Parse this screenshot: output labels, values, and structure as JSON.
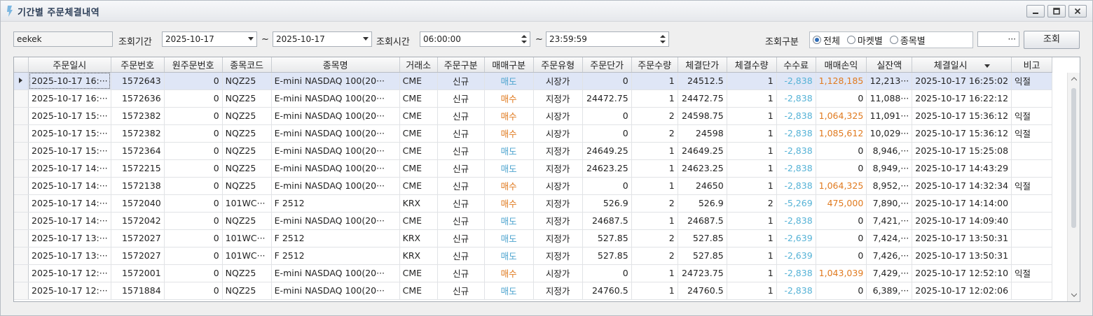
{
  "window": {
    "title": "기간별 주문체결내역",
    "controls": [
      "minimize-icon",
      "maximize-icon",
      "close-icon"
    ]
  },
  "toolbar": {
    "account": "eekek",
    "period_label": "조회기간",
    "date_from": "2025-10-17",
    "tilde1": "~",
    "date_to": "2025-10-17",
    "time_label": "조회시간",
    "time_from": "06:00:00",
    "tilde2": "~",
    "time_to": "23:59:59",
    "category_label": "조회구분",
    "radio_all": "전체",
    "radio_market": "마켓별",
    "radio_item": "종목별",
    "more_label": "···",
    "search_label": "조회"
  },
  "grid": {
    "columns": [
      "주문일시",
      "주문번호",
      "원주문번호",
      "종목코드",
      "종목명",
      "거래소",
      "주문구분",
      "매매구분",
      "주문유형",
      "주문단가",
      "주문수량",
      "체결단가",
      "체결수량",
      "수수료",
      "매매손익",
      "실잔액",
      "체결일시",
      "비고"
    ],
    "rows": [
      [
        "2025-10-17 16:···",
        "1572643",
        "0",
        "NQZ25",
        "E-mini NASDAQ 100(20···",
        "CME",
        "신규",
        "매도",
        "시장가",
        "0",
        "1",
        "24512.5",
        "1",
        "-2,838",
        "1,128,185",
        "12,213···",
        "2025-10-17 16:25:02",
        "익절"
      ],
      [
        "2025-10-17 16:···",
        "1572636",
        "0",
        "NQZ25",
        "E-mini NASDAQ 100(20···",
        "CME",
        "신규",
        "매수",
        "지정가",
        "24472.75",
        "1",
        "24472.75",
        "1",
        "-2,838",
        "0",
        "11,088···",
        "2025-10-17 16:22:12",
        ""
      ],
      [
        "2025-10-17 15:···",
        "1572382",
        "0",
        "NQZ25",
        "E-mini NASDAQ 100(20···",
        "CME",
        "신규",
        "매수",
        "시장가",
        "0",
        "2",
        "24598.75",
        "1",
        "-2,838",
        "1,064,325",
        "11,091···",
        "2025-10-17 15:36:12",
        "익절"
      ],
      [
        "2025-10-17 15:···",
        "1572382",
        "0",
        "NQZ25",
        "E-mini NASDAQ 100(20···",
        "CME",
        "신규",
        "매수",
        "시장가",
        "0",
        "2",
        "24598",
        "1",
        "-2,838",
        "1,085,612",
        "10,029···",
        "2025-10-17 15:36:12",
        "익절"
      ],
      [
        "2025-10-17 15:···",
        "1572364",
        "0",
        "NQZ25",
        "E-mini NASDAQ 100(20···",
        "CME",
        "신규",
        "매도",
        "지정가",
        "24649.25",
        "1",
        "24649.25",
        "1",
        "-2,838",
        "0",
        "8,946,···",
        "2025-10-17 15:25:08",
        ""
      ],
      [
        "2025-10-17 14:···",
        "1572215",
        "0",
        "NQZ25",
        "E-mini NASDAQ 100(20···",
        "CME",
        "신규",
        "매도",
        "지정가",
        "24623.25",
        "1",
        "24623.25",
        "1",
        "-2,838",
        "0",
        "8,949,···",
        "2025-10-17 14:43:29",
        ""
      ],
      [
        "2025-10-17 14:···",
        "1572138",
        "0",
        "NQZ25",
        "E-mini NASDAQ 100(20···",
        "CME",
        "신규",
        "매수",
        "시장가",
        "0",
        "1",
        "24650",
        "1",
        "-2,838",
        "1,064,325",
        "8,952,···",
        "2025-10-17 14:32:34",
        "익절"
      ],
      [
        "2025-10-17 14:···",
        "1572040",
        "0",
        "101WC···",
        "F 2512",
        "KRX",
        "신규",
        "매수",
        "지정가",
        "526.9",
        "2",
        "526.9",
        "2",
        "-5,269",
        "475,000",
        "7,890,···",
        "2025-10-17 14:14:00",
        ""
      ],
      [
        "2025-10-17 14:···",
        "1572042",
        "0",
        "NQZ25",
        "E-mini NASDAQ 100(20···",
        "CME",
        "신규",
        "매도",
        "지정가",
        "24687.5",
        "1",
        "24687.5",
        "1",
        "-2,838",
        "0",
        "7,421,···",
        "2025-10-17 14:09:40",
        ""
      ],
      [
        "2025-10-17 13:···",
        "1572027",
        "0",
        "101WC···",
        "F 2512",
        "KRX",
        "신규",
        "매도",
        "지정가",
        "527.85",
        "2",
        "527.85",
        "1",
        "-2,639",
        "0",
        "7,424,···",
        "2025-10-17 13:50:31",
        ""
      ],
      [
        "2025-10-17 13:···",
        "1572027",
        "0",
        "101WC···",
        "F 2512",
        "KRX",
        "신규",
        "매도",
        "지정가",
        "527.85",
        "2",
        "527.85",
        "1",
        "-2,639",
        "0",
        "7,426,···",
        "2025-10-17 13:50:31",
        ""
      ],
      [
        "2025-10-17 12:···",
        "1572001",
        "0",
        "NQZ25",
        "E-mini NASDAQ 100(20···",
        "CME",
        "신규",
        "매수",
        "시장가",
        "0",
        "1",
        "24723.75",
        "1",
        "-2,838",
        "1,043,039",
        "7,429,···",
        "2025-10-17 12:52:10",
        "익절"
      ],
      [
        "2025-10-17 12:···",
        "1571884",
        "0",
        "NQZ25",
        "E-mini NASDAQ 100(20···",
        "CME",
        "신규",
        "매도",
        "지정가",
        "24760.5",
        "1",
        "24760.5",
        "1",
        "-2,838",
        "0",
        "6,389,···",
        "2025-10-17 12:02:06",
        ""
      ]
    ]
  },
  "colors": {
    "sell": "#4ea4cf",
    "buy": "#e07a1f",
    "profit": "#e07a1f",
    "fee": "#55b2d6",
    "selected_row": "#dfe6f6"
  }
}
